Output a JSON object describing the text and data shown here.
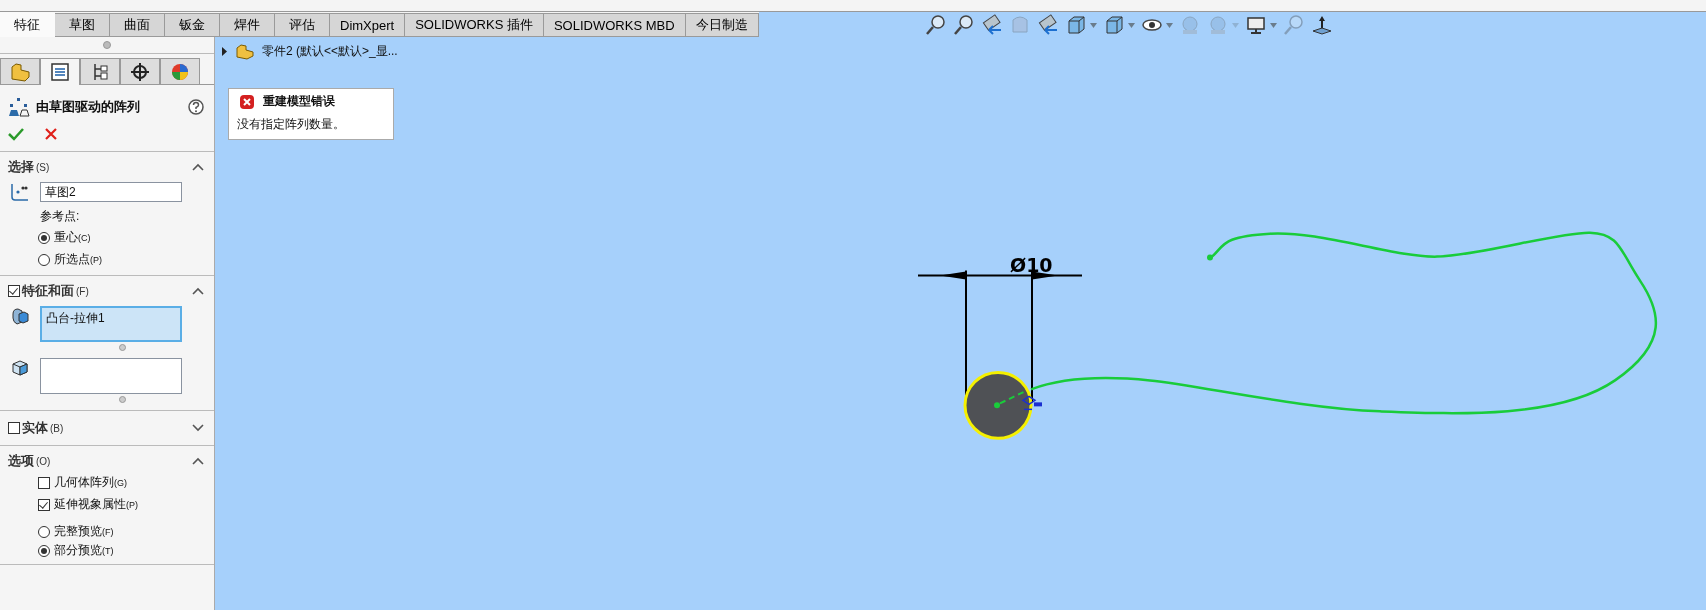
{
  "command_tabs": [
    {
      "label": "特征",
      "selected": true
    },
    {
      "label": "草图",
      "selected": false
    },
    {
      "label": "曲面",
      "selected": false
    },
    {
      "label": "钣金",
      "selected": false
    },
    {
      "label": "焊件",
      "selected": false
    },
    {
      "label": "评估",
      "selected": false
    },
    {
      "label": "DimXpert",
      "selected": false
    },
    {
      "label": "SOLIDWORKS 插件",
      "selected": false
    },
    {
      "label": "SOLIDWORKS MBD",
      "selected": false
    },
    {
      "label": "今日制造",
      "selected": false
    }
  ],
  "view_toolbar": [
    {
      "kind": "zoom-fit",
      "disabled": false,
      "dropdown": false
    },
    {
      "kind": "zoom-area",
      "disabled": false,
      "dropdown": false
    },
    {
      "kind": "previous-view",
      "disabled": false,
      "dropdown": false
    },
    {
      "kind": "section",
      "disabled": true,
      "dropdown": false
    },
    {
      "kind": "dynamic-annotation",
      "disabled": false,
      "dropdown": false
    },
    {
      "kind": "view-orientation",
      "disabled": false,
      "dropdown": true
    },
    {
      "kind": "display-style",
      "disabled": false,
      "dropdown": true
    },
    {
      "kind": "hide-show",
      "disabled": false,
      "dropdown": true
    },
    {
      "kind": "edit-appearance",
      "disabled": true,
      "dropdown": false
    },
    {
      "kind": "scene",
      "disabled": true,
      "dropdown": true
    },
    {
      "kind": "view-settings",
      "disabled": false,
      "dropdown": true
    },
    {
      "kind": "rotate",
      "disabled": true,
      "dropdown": false
    },
    {
      "kind": "triad",
      "disabled": false,
      "dropdown": false
    }
  ],
  "panel_tabs": [
    {
      "kind": "feature-tree",
      "selected": false
    },
    {
      "kind": "property-manager",
      "selected": true
    },
    {
      "kind": "configuration",
      "selected": false
    },
    {
      "kind": "dimxpert",
      "selected": false
    },
    {
      "kind": "display",
      "selected": false
    }
  ],
  "property_manager": {
    "title": "由草图驱动的阵列",
    "sections": [
      {
        "kind": "selection",
        "title": "选择",
        "mnemonic": "(S)",
        "expanded": true,
        "sketch_value": "草图2",
        "ref_label": "参考点:",
        "radios": [
          {
            "label": "重心",
            "mnemonic": "(C)",
            "selected": true
          },
          {
            "label": "所选点",
            "mnemonic": "(P)",
            "selected": false
          }
        ]
      },
      {
        "kind": "features",
        "title": "特征和面",
        "mnemonic": "(F)",
        "checked": true,
        "expanded": true,
        "features": [
          "凸台-拉伸1"
        ]
      },
      {
        "kind": "bodies",
        "title": "实体",
        "mnemonic": "(B)",
        "checked": false,
        "expanded": false
      },
      {
        "kind": "options",
        "title": "选项",
        "mnemonic": "(O)",
        "expanded": true,
        "checkboxes": [
          {
            "label": "几何体阵列",
            "mnemonic": "(G)",
            "checked": false
          },
          {
            "label": "延伸视象属性",
            "mnemonic": "(P)",
            "checked": true
          }
        ],
        "radios": [
          {
            "label": "完整预览",
            "mnemonic": "(F)",
            "selected": false
          },
          {
            "label": "部分预览",
            "mnemonic": "(T)",
            "selected": true
          }
        ]
      }
    ]
  },
  "feature_tree": {
    "label": "零件2  (默认<<默认>_显...",
    "expanded": false
  },
  "error_popup": {
    "title": "重建模型错误",
    "message": "没有指定阵列数量。"
  },
  "sketch": {
    "dimension": "Ø10"
  }
}
